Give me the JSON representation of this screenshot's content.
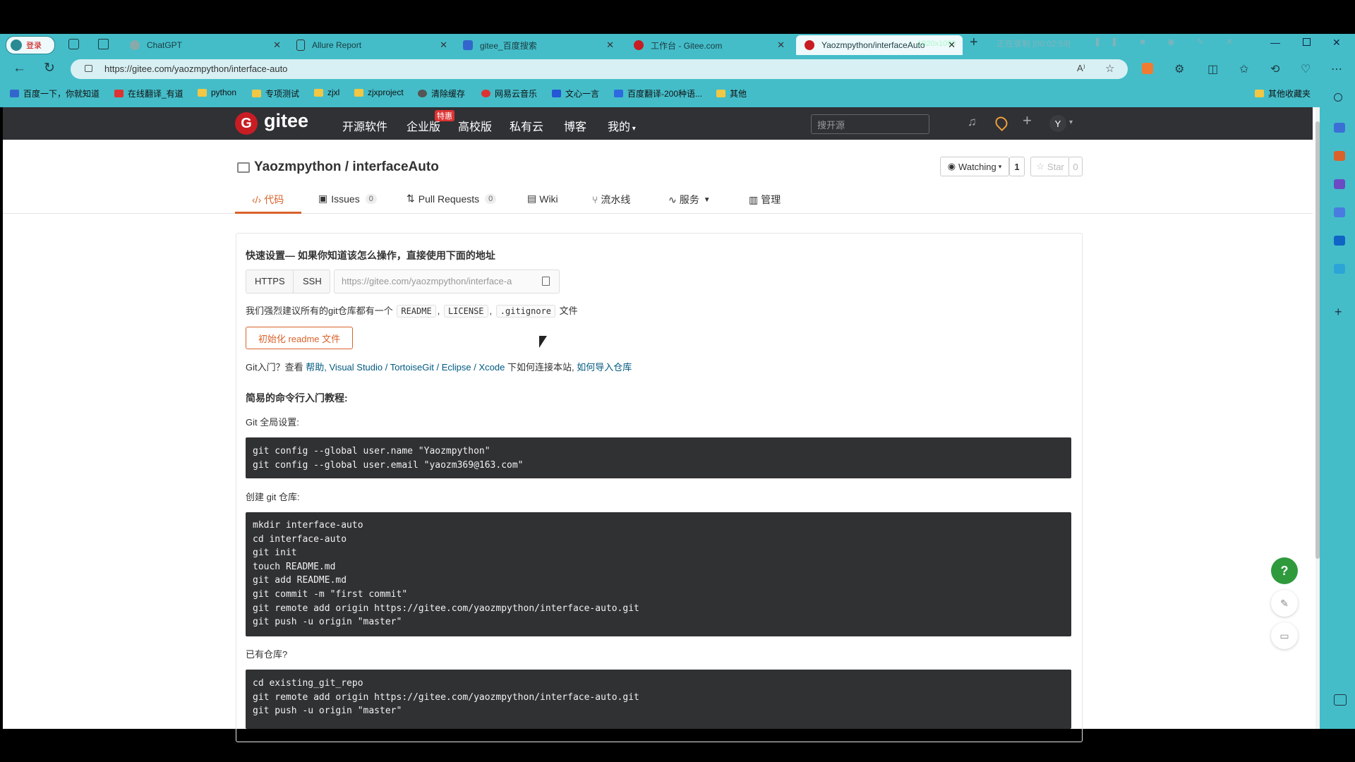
{
  "tabs": [
    {
      "label": "ChatGPT",
      "color": "#9aa"
    },
    {
      "label": "Allure Report",
      "color": "#6a8"
    },
    {
      "label": "gitee_百度搜索",
      "color": "#3366cc"
    },
    {
      "label": "工作台 - Gitee.com",
      "color": "#c71d23"
    },
    {
      "label": "Yaozmpython/interfaceAuto",
      "color": "#c71d23"
    }
  ],
  "profile_label": "登录",
  "tab_overlay_text": "1920x1080",
  "recording_text": "正在录制 [00:02:59]",
  "url": "https://gitee.com/yaozmpython/interface-auto",
  "bookmarks": [
    {
      "label": "百度一下，你就知道",
      "color": "#3366cc"
    },
    {
      "label": "在线翻译_有道",
      "color": "#d33"
    },
    {
      "label": "python",
      "color": "#f2c744"
    },
    {
      "label": "专项测试",
      "color": "#f2c744"
    },
    {
      "label": "zjxl",
      "color": "#f2c744"
    },
    {
      "label": "zjxproject",
      "color": "#f2c744"
    },
    {
      "label": "清除缓存",
      "color": "#555"
    },
    {
      "label": "网易云音乐",
      "color": "#d33"
    },
    {
      "label": "文心一言",
      "color": "#2456d6"
    },
    {
      "label": "百度翻译-200种语...",
      "color": "#2d6ae0"
    },
    {
      "label": "其他",
      "color": "#f2c744"
    }
  ],
  "other_bookmarks": "其他收藏夹",
  "gitee": {
    "logo": "gitee",
    "nav": [
      "开源软件",
      "企业版",
      "高校版",
      "私有云",
      "博客",
      "我的"
    ],
    "enterprise_badge": "特惠",
    "search_placeholder": "搜开源",
    "avatar": "Y"
  },
  "repo": {
    "owner": "Yaozmpython",
    "name": "interfaceAuto",
    "watching": "Watching",
    "watch_count": "1",
    "star": "Star",
    "star_count": "0"
  },
  "repo_tabs": [
    {
      "label": "代码",
      "badge": ""
    },
    {
      "label": "Issues",
      "badge": "0"
    },
    {
      "label": "Pull Requests",
      "badge": "0"
    },
    {
      "label": "Wiki",
      "badge": ""
    },
    {
      "label": "流水线",
      "badge": ""
    },
    {
      "label": "服务",
      "badge": ""
    },
    {
      "label": "管理",
      "badge": ""
    }
  ],
  "quick": {
    "title": "快速设置— 如果你知道该怎么操作，直接使用下面的地址",
    "https": "HTTPS",
    "ssh": "SSH",
    "clone_url": "https://gitee.com/yaozmpython/interface-a",
    "recommend_prefix": "我们强烈建议所有的git仓库都有一个",
    "files": [
      "README",
      "LICENSE",
      ".gitignore"
    ],
    "recommend_suffix": "文件",
    "init_button": "初始化 readme 文件",
    "git_intro_prefix": "Git入门？查看",
    "help": "帮助",
    "tools": ", Visual Studio / TortoiseGit / Eclipse / Xcode",
    "connect": "下如何连接本站,",
    "import": "如何导入仓库"
  },
  "tutorial": {
    "title": "简易的命令行入门教程:",
    "global_label": "Git 全局设置:",
    "global_cmds": [
      "git config --global user.name \"Yaozmpython\"",
      "git config --global user.email \"yaozm369@163.com\""
    ],
    "create_label": "创建 git 仓库:",
    "create_cmds": [
      "mkdir interface-auto",
      "cd interface-auto",
      "git init",
      "touch README.md",
      "git add README.md",
      "git commit -m \"first commit\"",
      "git remote add origin https://gitee.com/yaozmpython/interface-auto.git",
      "git push -u origin \"master\""
    ],
    "existing_label": "已有仓库?",
    "existing_cmds": [
      "cd existing_git_repo",
      "git remote add origin https://gitee.com/yaozmpython/interface-auto.git",
      "git push -u origin \"master\""
    ]
  },
  "fab": "?"
}
